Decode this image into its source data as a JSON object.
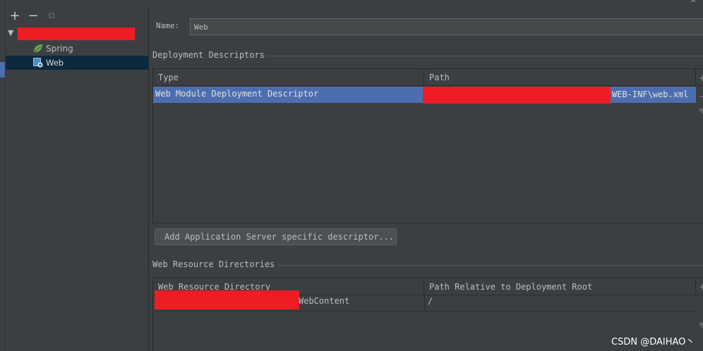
{
  "window": {
    "close_glyph": "✕"
  },
  "tree": {
    "toolbar": {
      "add": "+",
      "remove": "−",
      "copy": "⧉"
    },
    "root_arrow": "▼",
    "items": [
      {
        "label": "Spring",
        "icon": "spring-leaf-icon"
      },
      {
        "label": "Web",
        "icon": "web-facet-icon",
        "selected": true
      }
    ]
  },
  "facet": {
    "name_label": "Name:",
    "name_value": "Web",
    "deployment_descriptors": {
      "title": "Deployment Descriptors",
      "columns": [
        "Type",
        "Path"
      ],
      "rows": [
        {
          "type": "Web Module Deployment Descriptor",
          "path_suffix": "WEB-INF\\web.xml",
          "selected": true
        }
      ],
      "add_button": "Add Application Server specific descriptor..."
    },
    "web_resource_directories": {
      "title": "Web Resource Directories",
      "columns": [
        "Web Resource Directory",
        "Path Relative to Deployment Root"
      ],
      "rows": [
        {
          "directory_suffix": "WebContent",
          "relative_path": "/"
        }
      ]
    }
  },
  "watermark": "CSDN @DAIHAO丶",
  "colors": {
    "background": "#3c3f41",
    "selection": "#4b6eaf",
    "tree_selection": "#0d293e",
    "redaction": "#ee1c25"
  }
}
